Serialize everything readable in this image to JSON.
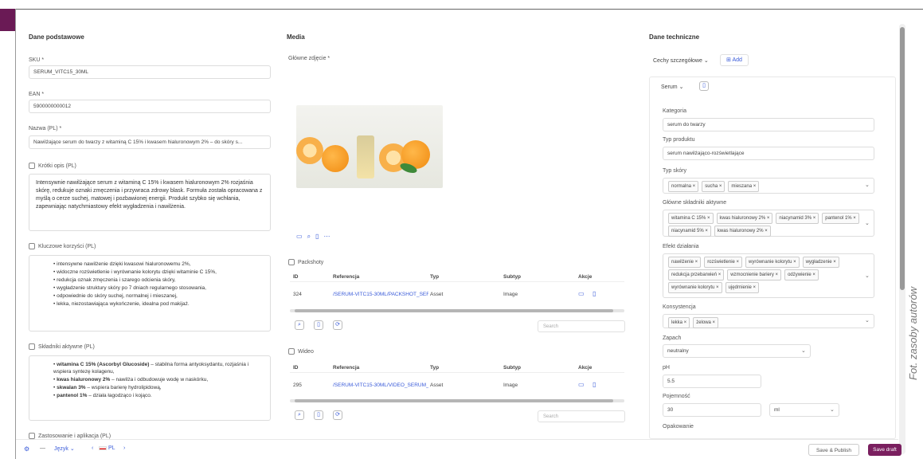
{
  "caption": "Fot. zasoby autorów",
  "columns": {
    "left": "Dane podstawowe",
    "middle": "Media",
    "right": "Dane techniczne"
  },
  "left": {
    "sku_label": "SKU *",
    "sku_value": "SERUM_VITC15_30ML",
    "ean_label": "EAN *",
    "ean_value": "5900000000012",
    "name_label": "Nazwa (PL) *",
    "name_value": "Nawilżające serum do twarzy z witaminą C 15% i kwasem hialuronowym 2% – do skóry s...",
    "short_label": "Krótki opis (PL)",
    "short_text": "Intensywnie nawilżające serum z witaminą C 15% i kwasem hialuronowym 2% rozjaśnia skórę, redukuje oznaki zmęczenia i przywraca zdrowy blask. Formuła została opracowana z myślą o cerze suchej, matowej i pozbawionej energii. Produkt szybko się wchłania, zapewniając natychmiastowy efekt wygładzenia i nawilżenia.",
    "benefits_label": "Kluczowe korzyści (PL)",
    "benefits": [
      "intensywne nawilżenie dzięki kwasowi hialuronowemu 2%,",
      "widoczne rozświetlenie i wyrównanie kolorytu dzięki witaminie C 15%,",
      "redukcja oznak zmęczenia i szarego odcienia skóry,",
      "wygładzenie struktury skóry po 7 dniach regularnego stosowania,",
      "odpowiednie do skóry suchej, normalnej i mieszanej,",
      "lekka, niezostawiająca wykończenie, idealna pod makijaż."
    ],
    "actives_label": "Składniki aktywne (PL)",
    "actives": [
      {
        "b": "witamina C 15% (Ascorbyl Glucoside)",
        "t": " – stabilna forma antyoksydantu, rozjaśnia i wspiera syntezę kolagenu,"
      },
      {
        "b": "kwas hialuronowy 2%",
        "t": " – nawilża i odbudowuje wodę w naskórku,"
      },
      {
        "b": "skwalan 3%",
        "t": " – wspiera barierę hydrolipidową,"
      },
      {
        "b": "pantenol 1%",
        "t": " – działa łagodząco i kojąco."
      }
    ],
    "usage_label": "Zastosowanie i aplikacja (PL)"
  },
  "media": {
    "main_label": "Główne zdjęcie *",
    "pictures_label": "Packshoty",
    "videos_label": "Wideo",
    "headers": [
      "ID",
      "Referencja",
      "Typ",
      "Subtyp",
      "Akcje"
    ],
    "picture_row": [
      "324",
      "/SERUM-VITC15-30ML/PACKSHOT_SERUM_M...",
      "Asset",
      "Image"
    ],
    "video_row": [
      "295",
      "/SERUM-VITC15-30ML/VIDEO_SERUM_M...",
      "Asset",
      "Image"
    ],
    "search_placeholder": "Search"
  },
  "right": {
    "group_select": "Cechy szczegółowe",
    "add_label": "Add",
    "sub_select": "Serum",
    "category_label": "Kategoria",
    "category_value": "serum do twarzy",
    "ptype_label": "Typ produktu",
    "ptype_value": "serum nawilżająco-rozświetlające",
    "skin_label": "Typ skóry",
    "skin_chips": [
      "normalna",
      "sucha",
      "mieszana"
    ],
    "actives_label": "Główne składniki aktywne",
    "actives_chips": [
      "witamina C 15%",
      "kwas hialuronowy 2%",
      "niacynamid 3%",
      "pantenol 1%",
      "niacynamid 5%",
      "kwas hialuronowy 2%"
    ],
    "effect_label": "Efekt działania",
    "effect_chips": [
      "nawilżenie",
      "rozświetlenie",
      "wyrównanie kolorytu",
      "wygładzenie",
      "redukcja przebarwień",
      "wzmocnienie bariery",
      "odżywienie",
      "wyrównanie kolorytu",
      "ujędrnienie"
    ],
    "consistency_label": "Konsystencja",
    "consistency_chips": [
      "lekka",
      "żelowa"
    ],
    "scent_label": "Zapach",
    "scent_value": "neutralny",
    "ph_label": "pH",
    "ph_value": "5.5",
    "capacity_label": "Pojemność",
    "capacity_value": "30",
    "capacity_unit": "ml",
    "storage_label": "Opakowanie"
  },
  "bottom": {
    "lang": "Język",
    "flag_label": "PL",
    "save_publish": "Save & Publish",
    "save_draft": "Save draft"
  }
}
